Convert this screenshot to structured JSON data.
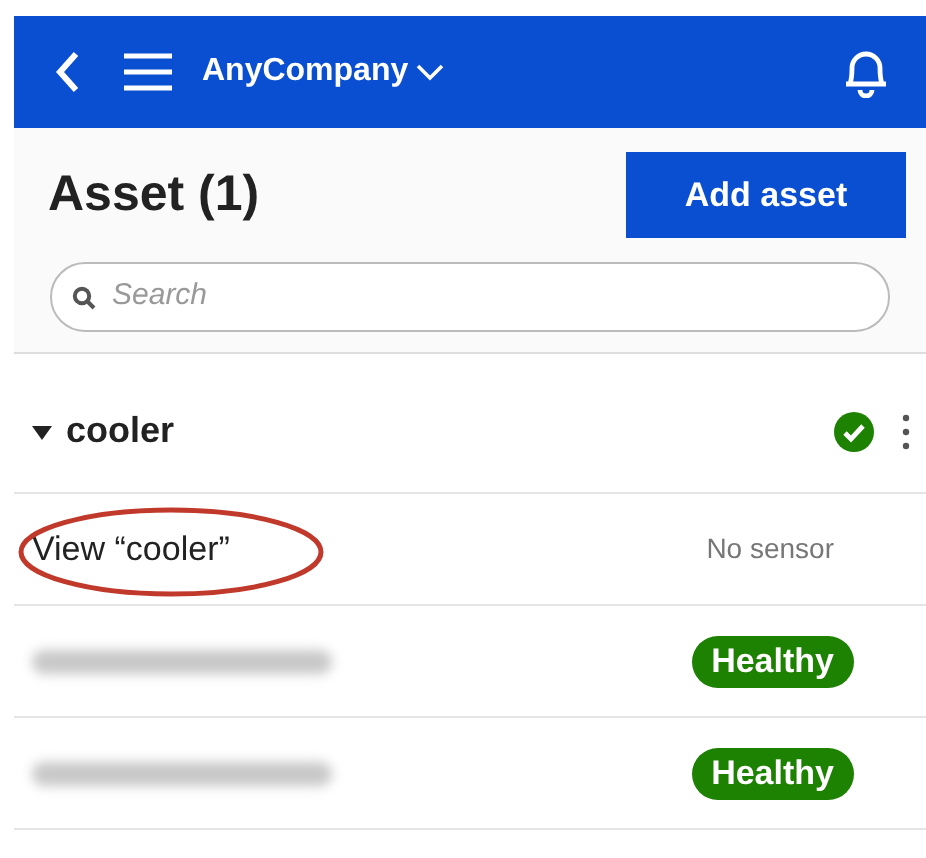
{
  "header": {
    "company": "AnyCompany"
  },
  "page": {
    "title": "Asset (1)",
    "add_button": "Add asset"
  },
  "search": {
    "placeholder": "Search"
  },
  "group": {
    "name": "cooler",
    "expanded": true,
    "healthy": true
  },
  "rows": [
    {
      "kind": "view",
      "label": "View “cooler”",
      "status": "No sensor",
      "circled": true
    },
    {
      "kind": "sensor",
      "status": "Healthy"
    },
    {
      "kind": "sensor",
      "status": "Healthy"
    }
  ]
}
